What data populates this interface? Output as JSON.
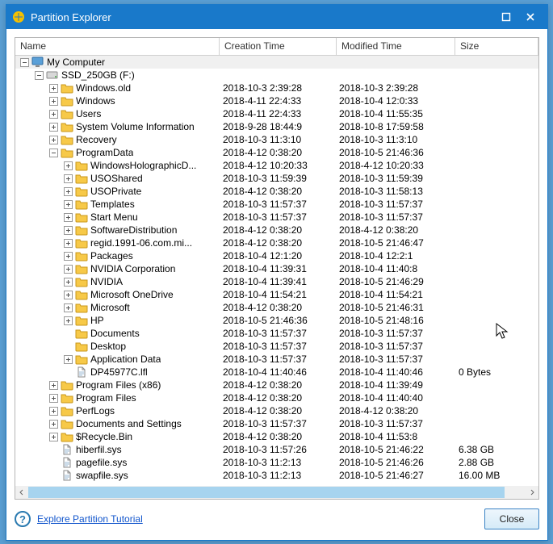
{
  "window": {
    "title": "Partition Explorer"
  },
  "columns": {
    "name": "Name",
    "ctime": "Creation Time",
    "mtime": "Modified Time",
    "size": "Size"
  },
  "footer": {
    "tutorial": "Explore Partition Tutorial",
    "close": "Close"
  },
  "rows": [
    {
      "depth": 0,
      "exp": "minus",
      "icon": "computer",
      "name": "My Computer",
      "ctime": "",
      "mtime": "",
      "size": "",
      "root": true
    },
    {
      "depth": 1,
      "exp": "minus",
      "icon": "disk",
      "name": "SSD_250GB (F:)",
      "ctime": "",
      "mtime": "",
      "size": ""
    },
    {
      "depth": 2,
      "exp": "plus",
      "icon": "folder",
      "name": "Windows.old",
      "ctime": "2018-10-3 2:39:28",
      "mtime": "2018-10-3 2:39:28",
      "size": ""
    },
    {
      "depth": 2,
      "exp": "plus",
      "icon": "folder",
      "name": "Windows",
      "ctime": "2018-4-11 22:4:33",
      "mtime": "2018-10-4 12:0:33",
      "size": ""
    },
    {
      "depth": 2,
      "exp": "plus",
      "icon": "folder",
      "name": "Users",
      "ctime": "2018-4-11 22:4:33",
      "mtime": "2018-10-4 11:55:35",
      "size": ""
    },
    {
      "depth": 2,
      "exp": "plus",
      "icon": "folder",
      "name": "System Volume Information",
      "ctime": "2018-9-28 18:44:9",
      "mtime": "2018-10-8 17:59:58",
      "size": ""
    },
    {
      "depth": 2,
      "exp": "plus",
      "icon": "folder",
      "name": "Recovery",
      "ctime": "2018-10-3 11:3:10",
      "mtime": "2018-10-3 11:3:10",
      "size": ""
    },
    {
      "depth": 2,
      "exp": "minus",
      "icon": "folder",
      "name": "ProgramData",
      "ctime": "2018-4-12 0:38:20",
      "mtime": "2018-10-5 21:46:36",
      "size": ""
    },
    {
      "depth": 3,
      "exp": "plus",
      "icon": "folder",
      "name": "WindowsHolographicD...",
      "ctime": "2018-4-12 10:20:33",
      "mtime": "2018-4-12 10:20:33",
      "size": ""
    },
    {
      "depth": 3,
      "exp": "plus",
      "icon": "folder",
      "name": "USOShared",
      "ctime": "2018-10-3 11:59:39",
      "mtime": "2018-10-3 11:59:39",
      "size": ""
    },
    {
      "depth": 3,
      "exp": "plus",
      "icon": "folder",
      "name": "USOPrivate",
      "ctime": "2018-4-12 0:38:20",
      "mtime": "2018-10-3 11:58:13",
      "size": ""
    },
    {
      "depth": 3,
      "exp": "plus",
      "icon": "folder",
      "name": "Templates",
      "ctime": "2018-10-3 11:57:37",
      "mtime": "2018-10-3 11:57:37",
      "size": ""
    },
    {
      "depth": 3,
      "exp": "plus",
      "icon": "folder",
      "name": "Start Menu",
      "ctime": "2018-10-3 11:57:37",
      "mtime": "2018-10-3 11:57:37",
      "size": ""
    },
    {
      "depth": 3,
      "exp": "plus",
      "icon": "folder",
      "name": "SoftwareDistribution",
      "ctime": "2018-4-12 0:38:20",
      "mtime": "2018-4-12 0:38:20",
      "size": ""
    },
    {
      "depth": 3,
      "exp": "plus",
      "icon": "folder",
      "name": "regid.1991-06.com.mi...",
      "ctime": "2018-4-12 0:38:20",
      "mtime": "2018-10-5 21:46:47",
      "size": ""
    },
    {
      "depth": 3,
      "exp": "plus",
      "icon": "folder",
      "name": "Packages",
      "ctime": "2018-10-4 12:1:20",
      "mtime": "2018-10-4 12:2:1",
      "size": ""
    },
    {
      "depth": 3,
      "exp": "plus",
      "icon": "folder",
      "name": "NVIDIA Corporation",
      "ctime": "2018-10-4 11:39:31",
      "mtime": "2018-10-4 11:40:8",
      "size": ""
    },
    {
      "depth": 3,
      "exp": "plus",
      "icon": "folder",
      "name": "NVIDIA",
      "ctime": "2018-10-4 11:39:41",
      "mtime": "2018-10-5 21:46:29",
      "size": ""
    },
    {
      "depth": 3,
      "exp": "plus",
      "icon": "folder",
      "name": "Microsoft OneDrive",
      "ctime": "2018-10-4 11:54:21",
      "mtime": "2018-10-4 11:54:21",
      "size": ""
    },
    {
      "depth": 3,
      "exp": "plus",
      "icon": "folder",
      "name": "Microsoft",
      "ctime": "2018-4-12 0:38:20",
      "mtime": "2018-10-5 21:46:31",
      "size": ""
    },
    {
      "depth": 3,
      "exp": "plus",
      "icon": "folder",
      "name": "HP",
      "ctime": "2018-10-5 21:46:36",
      "mtime": "2018-10-5 21:48:16",
      "size": ""
    },
    {
      "depth": 3,
      "exp": "none",
      "icon": "folder",
      "name": "Documents",
      "ctime": "2018-10-3 11:57:37",
      "mtime": "2018-10-3 11:57:37",
      "size": ""
    },
    {
      "depth": 3,
      "exp": "none",
      "icon": "folder",
      "name": "Desktop",
      "ctime": "2018-10-3 11:57:37",
      "mtime": "2018-10-3 11:57:37",
      "size": ""
    },
    {
      "depth": 3,
      "exp": "plus",
      "icon": "folder",
      "name": "Application Data",
      "ctime": "2018-10-3 11:57:37",
      "mtime": "2018-10-3 11:57:37",
      "size": ""
    },
    {
      "depth": 3,
      "exp": "none",
      "icon": "file",
      "name": "DP45977C.lfl",
      "ctime": "2018-10-4 11:40:46",
      "mtime": "2018-10-4 11:40:46",
      "size": "0 Bytes"
    },
    {
      "depth": 2,
      "exp": "plus",
      "icon": "folder",
      "name": "Program Files (x86)",
      "ctime": "2018-4-12 0:38:20",
      "mtime": "2018-10-4 11:39:49",
      "size": ""
    },
    {
      "depth": 2,
      "exp": "plus",
      "icon": "folder",
      "name": "Program Files",
      "ctime": "2018-4-12 0:38:20",
      "mtime": "2018-10-4 11:40:40",
      "size": ""
    },
    {
      "depth": 2,
      "exp": "plus",
      "icon": "folder",
      "name": "PerfLogs",
      "ctime": "2018-4-12 0:38:20",
      "mtime": "2018-4-12 0:38:20",
      "size": ""
    },
    {
      "depth": 2,
      "exp": "plus",
      "icon": "folder",
      "name": "Documents and Settings",
      "ctime": "2018-10-3 11:57:37",
      "mtime": "2018-10-3 11:57:37",
      "size": ""
    },
    {
      "depth": 2,
      "exp": "plus",
      "icon": "folder",
      "name": "$Recycle.Bin",
      "ctime": "2018-4-12 0:38:20",
      "mtime": "2018-10-4 11:53:8",
      "size": ""
    },
    {
      "depth": 2,
      "exp": "none",
      "icon": "file",
      "name": "hiberfil.sys",
      "ctime": "2018-10-3 11:57:26",
      "mtime": "2018-10-5 21:46:22",
      "size": "6.38 GB"
    },
    {
      "depth": 2,
      "exp": "none",
      "icon": "file",
      "name": "pagefile.sys",
      "ctime": "2018-10-3 11:2:13",
      "mtime": "2018-10-5 21:46:26",
      "size": "2.88 GB"
    },
    {
      "depth": 2,
      "exp": "none",
      "icon": "file",
      "name": "swapfile.sys",
      "ctime": "2018-10-3 11:2:13",
      "mtime": "2018-10-5 21:46:27",
      "size": "16.00 MB"
    }
  ]
}
